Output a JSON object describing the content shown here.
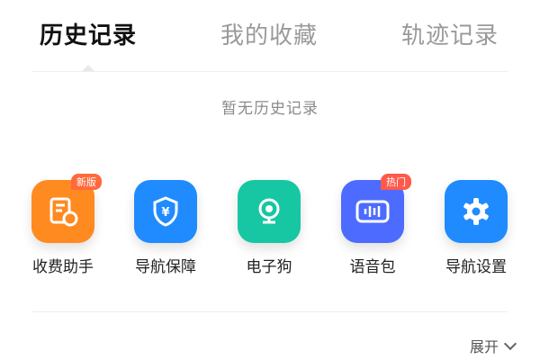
{
  "tabs": [
    {
      "label": "历史记录",
      "active": true
    },
    {
      "label": "我的收藏",
      "active": false
    },
    {
      "label": "轨迹记录",
      "active": false
    }
  ],
  "empty_state": {
    "text": "暂无历史记录"
  },
  "tools": [
    {
      "label": "收费助手",
      "icon": "toll-document-icon",
      "color": "#ff8a1f",
      "badge": "新版",
      "badge_color": "#ff6a3d"
    },
    {
      "label": "导航保障",
      "icon": "shield-icon",
      "color": "#1f8bff",
      "badge": "",
      "badge_color": ""
    },
    {
      "label": "电子狗",
      "icon": "camera-icon",
      "color": "#17c7a3",
      "badge": "",
      "badge_color": ""
    },
    {
      "label": "语音包",
      "icon": "voice-wave-icon",
      "color": "#4d6bff",
      "badge": "热门",
      "badge_color": "#ff5a4a"
    },
    {
      "label": "导航设置",
      "icon": "gear-icon",
      "color": "#1f8bff",
      "badge": "",
      "badge_color": ""
    }
  ],
  "expand": {
    "label": "展开",
    "icon": "chevron-down-icon"
  }
}
